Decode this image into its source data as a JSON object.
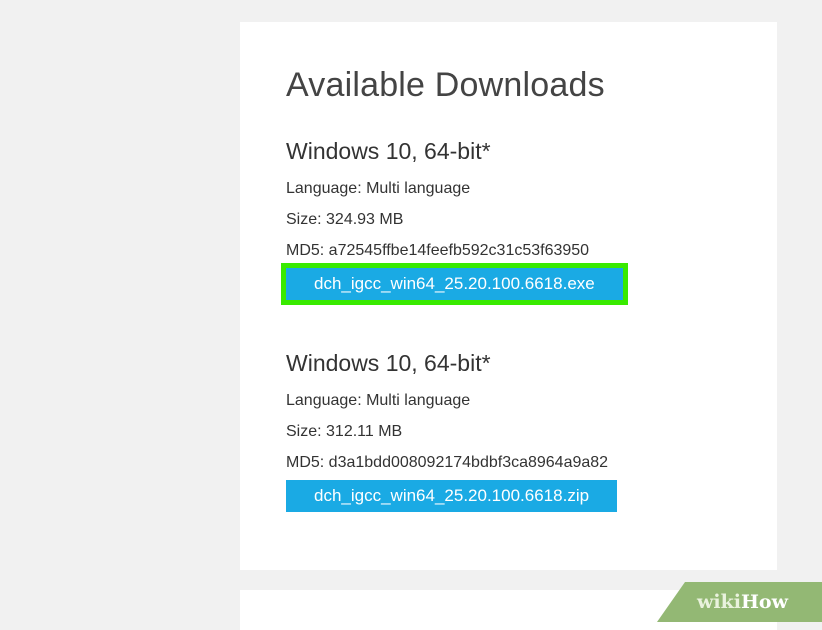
{
  "page": {
    "title": "Available Downloads"
  },
  "downloads": [
    {
      "heading": "Windows 10, 64-bit*",
      "language": "Language: Multi language",
      "size": "Size: 324.93 MB",
      "md5": "MD5: a72545ffbe14feefb592c31c53f63950",
      "button_label": "dch_igcc_win64_25.20.100.6618.exe",
      "highlighted": true
    },
    {
      "heading": "Windows 10, 64-bit*",
      "language": "Language: Multi language",
      "size": "Size: 312.11 MB",
      "md5": "MD5: d3a1bdd008092174bdbf3ca8964a9a82",
      "button_label": "dch_igcc_win64_25.20.100.6618.zip",
      "highlighted": false
    }
  ],
  "watermark": {
    "wiki": "wiki",
    "how": "How"
  },
  "colors": {
    "button": "#1aaae4",
    "highlight": "#39ea00",
    "background": "#f1f1f1"
  }
}
